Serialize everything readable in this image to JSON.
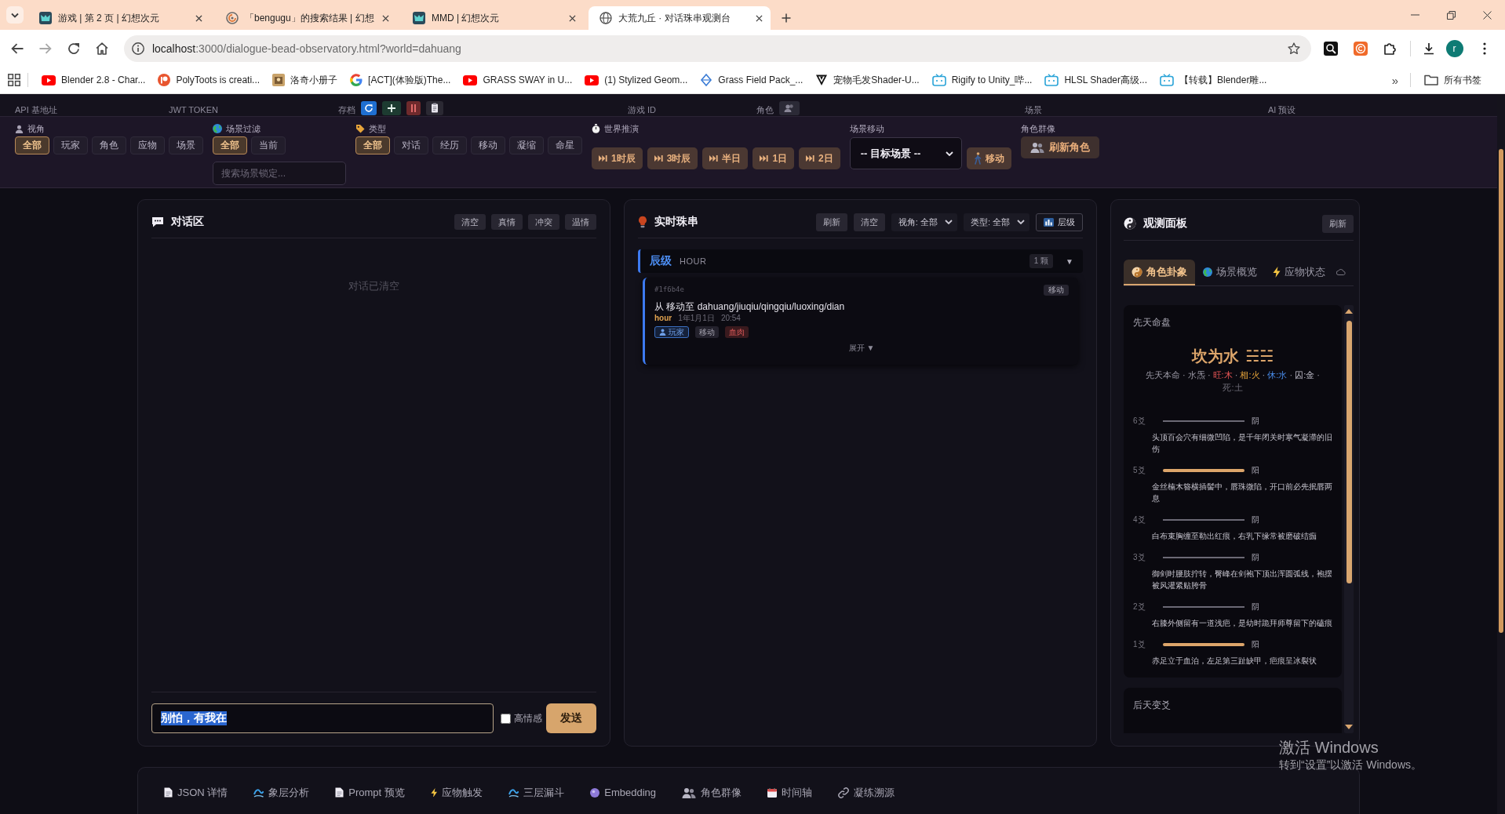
{
  "browser": {
    "tabs": [
      {
        "title": "游戏 | 第 2 页 | 幻想次元",
        "kind": "logo",
        "selected": false
      },
      {
        "title": "「bengugu」的搜索结果 | 幻想",
        "kind": "swirl",
        "selected": false
      },
      {
        "title": "MMD | 幻想次元",
        "kind": "logo",
        "selected": false
      },
      {
        "title": "大荒九丘 · 对话珠串观测台",
        "kind": "globe",
        "selected": true
      }
    ],
    "address": {
      "host": "localhost",
      "path": ":3000/dialogue-bead-observatory.html?world=dahuang"
    },
    "profile_initial": "r",
    "bookmarks": [
      {
        "label": "Blender 2.8 - Char...",
        "kind": "youtube"
      },
      {
        "label": "PolyToots is creati...",
        "kind": "patreon"
      },
      {
        "label": "洛奇小册子",
        "kind": "book"
      },
      {
        "label": "[ACT](体验版)The...",
        "kind": "google"
      },
      {
        "label": "GRASS SWAY in U...",
        "kind": "youtube"
      },
      {
        "label": "(1) Stylized Geom...",
        "kind": "youtube"
      },
      {
        "label": "Grass Field Pack_...",
        "kind": "asset"
      },
      {
        "label": "宠物毛发Shader-U...",
        "kind": "shield"
      },
      {
        "label": "Rigify to Unity_哔...",
        "kind": "tv"
      },
      {
        "label": "HLSL Shader高级...",
        "kind": "tv"
      },
      {
        "label": "【转载】Blender雕...",
        "kind": "tv"
      }
    ],
    "more": "»",
    "all_bookmarks": "所有书签"
  },
  "config_bar": [
    {
      "label": "API 基地址",
      "kind": "plain"
    },
    {
      "label": "JWT TOKEN",
      "kind": "plain"
    },
    {
      "label": "存档",
      "kind": "save"
    },
    {
      "label": "游戏 ID",
      "kind": "plain"
    },
    {
      "label": "角色",
      "kind": "role"
    },
    {
      "label": "场景",
      "kind": "plain"
    },
    {
      "label": "AI 预设",
      "kind": "plain"
    }
  ],
  "filters": {
    "perspective": {
      "label": "视角",
      "options": [
        {
          "label": "全部",
          "selected": true
        },
        {
          "label": "玩家",
          "selected": false
        },
        {
          "label": "角色",
          "selected": false
        },
        {
          "label": "应物",
          "selected": false
        },
        {
          "label": "场景",
          "selected": false
        }
      ]
    },
    "scene": {
      "label": "场景过滤",
      "options": [
        {
          "label": "全部",
          "selected": true
        },
        {
          "label": "当前",
          "selected": false
        }
      ],
      "search": {
        "placeholder": "搜索场景锁定..."
      }
    },
    "type": {
      "label": "类型",
      "options": [
        {
          "label": "全部",
          "selected": true
        },
        {
          "label": "对话",
          "selected": false
        },
        {
          "label": "经历",
          "selected": false
        },
        {
          "label": "移动",
          "selected": false
        },
        {
          "label": "凝缩",
          "selected": false
        },
        {
          "label": "命星",
          "selected": false
        }
      ]
    },
    "world": {
      "label": "世界推演",
      "steps": [
        "1时辰",
        "3时辰",
        "半日",
        "1日",
        "2日"
      ]
    },
    "move": {
      "label": "场景移动",
      "target": "-- 目标场景 --",
      "button": "移动"
    },
    "roles": {
      "label": "角色群像",
      "button": "刷新角色"
    }
  },
  "dialogue": {
    "title": "对话区",
    "actions": [
      "清空",
      "真情",
      "冲突",
      "温情"
    ],
    "empty_text": "对话已清空",
    "input": {
      "value": "别怕，有我在",
      "highlighted": true
    },
    "option": {
      "label": "高情感",
      "checked": false
    },
    "send": "发送"
  },
  "beads": {
    "title": "实时珠串",
    "actions": [
      "刷新",
      "清空"
    ],
    "selects": [
      "视角: 全部",
      "类型: 全部"
    ],
    "layers_button": "层级",
    "groups": [
      {
        "level": "辰级",
        "code": "HOUR",
        "count": "1 颗",
        "toggle": "▼",
        "expanded": true,
        "beads": [
          {
            "id": "#1f6b4e",
            "badge": "移动",
            "text": "从 移动至 dahuang/jiuqiu/qingqiu/luoxing/dian",
            "granularity": "hour",
            "date": "1年1月1日",
            "time": "20:54",
            "tags": [
              {
                "label": "玩家",
                "kind": "actor"
              },
              {
                "label": "移动",
                "kind": "type"
              },
              {
                "label": "血肉",
                "kind": "layer"
              }
            ],
            "expand": "展开 ▼"
          }
        ]
      }
    ]
  },
  "observer": {
    "title": "观测面板",
    "refresh": "刷新",
    "tabs": [
      {
        "label": "角色卦象",
        "kind": "yinyang",
        "selected": true
      },
      {
        "label": "场景概览",
        "kind": "globe",
        "selected": false
      },
      {
        "label": "应物状态",
        "kind": "bolt",
        "selected": false
      },
      {
        "kind": "cloud",
        "selected": false
      }
    ],
    "natal": {
      "heading": "先天命盘",
      "hexagram": "坎为水",
      "symbol": "☵☵",
      "separator": "·",
      "phases": [
        {
          "text": "先天本命",
          "kind": "plain"
        },
        {
          "text": "水炁",
          "kind": "plain"
        },
        {
          "text": "旺:木",
          "kind": "wang"
        },
        {
          "text": "相:火",
          "kind": "xiang"
        },
        {
          "text": "休:水",
          "kind": "xiu"
        },
        {
          "text": "囚:金",
          "kind": "qiu"
        },
        {
          "text": "死:土",
          "kind": "si"
        }
      ],
      "lines": [
        {
          "label": "6爻",
          "kind": "yin",
          "tag": "阴",
          "text": "头顶百会穴有细微凹陷，是千年闭关时寒气凝滞的旧伤"
        },
        {
          "label": "5爻",
          "kind": "yang",
          "tag": "阳",
          "text": "金丝楠木簪横插髻中，唇珠微陷，开口前必先抿唇两息"
        },
        {
          "label": "4爻",
          "kind": "yin",
          "tag": "阴",
          "text": "白布束胸缠至勒出红痕，右乳下缘常被磨破结痂"
        },
        {
          "label": "3爻",
          "kind": "yin",
          "tag": "阴",
          "text": "御剑时腰肢拧转，臀峰在剑袍下顶出浑圆弧线，袍摆被风灌紧贴胯骨"
        },
        {
          "label": "2爻",
          "kind": "yin",
          "tag": "阴",
          "text": "右膝外侧留有一道浅疤，是幼时跪拜师尊留下的磕痕"
        },
        {
          "label": "1爻",
          "kind": "yang",
          "tag": "阳",
          "text": "赤足立于血泊，左足第三趾缺甲，疤痕呈冰裂状"
        }
      ]
    },
    "changed": {
      "heading": "后天变爻"
    }
  },
  "bottom_tabs": [
    {
      "label": "JSON 详情",
      "kind": "doc",
      "selected": false
    },
    {
      "label": "象层分析",
      "kind": "wave",
      "selected": false
    },
    {
      "label": "Prompt 预览",
      "kind": "doc",
      "selected": false
    },
    {
      "label": "应物触发",
      "kind": "bolt",
      "selected": false
    },
    {
      "label": "三层漏斗",
      "kind": "wave",
      "selected": false
    },
    {
      "label": "Embedding",
      "kind": "orb",
      "selected": false
    },
    {
      "label": "角色群像",
      "kind": "people",
      "selected": false
    },
    {
      "label": "时间轴",
      "kind": "calendar",
      "selected": false
    },
    {
      "label": "凝练溯源",
      "kind": "link",
      "selected": false
    }
  ],
  "os_notice": {
    "title": "激活 Windows",
    "hint": "转到“设置”以激活 Windows。"
  }
}
